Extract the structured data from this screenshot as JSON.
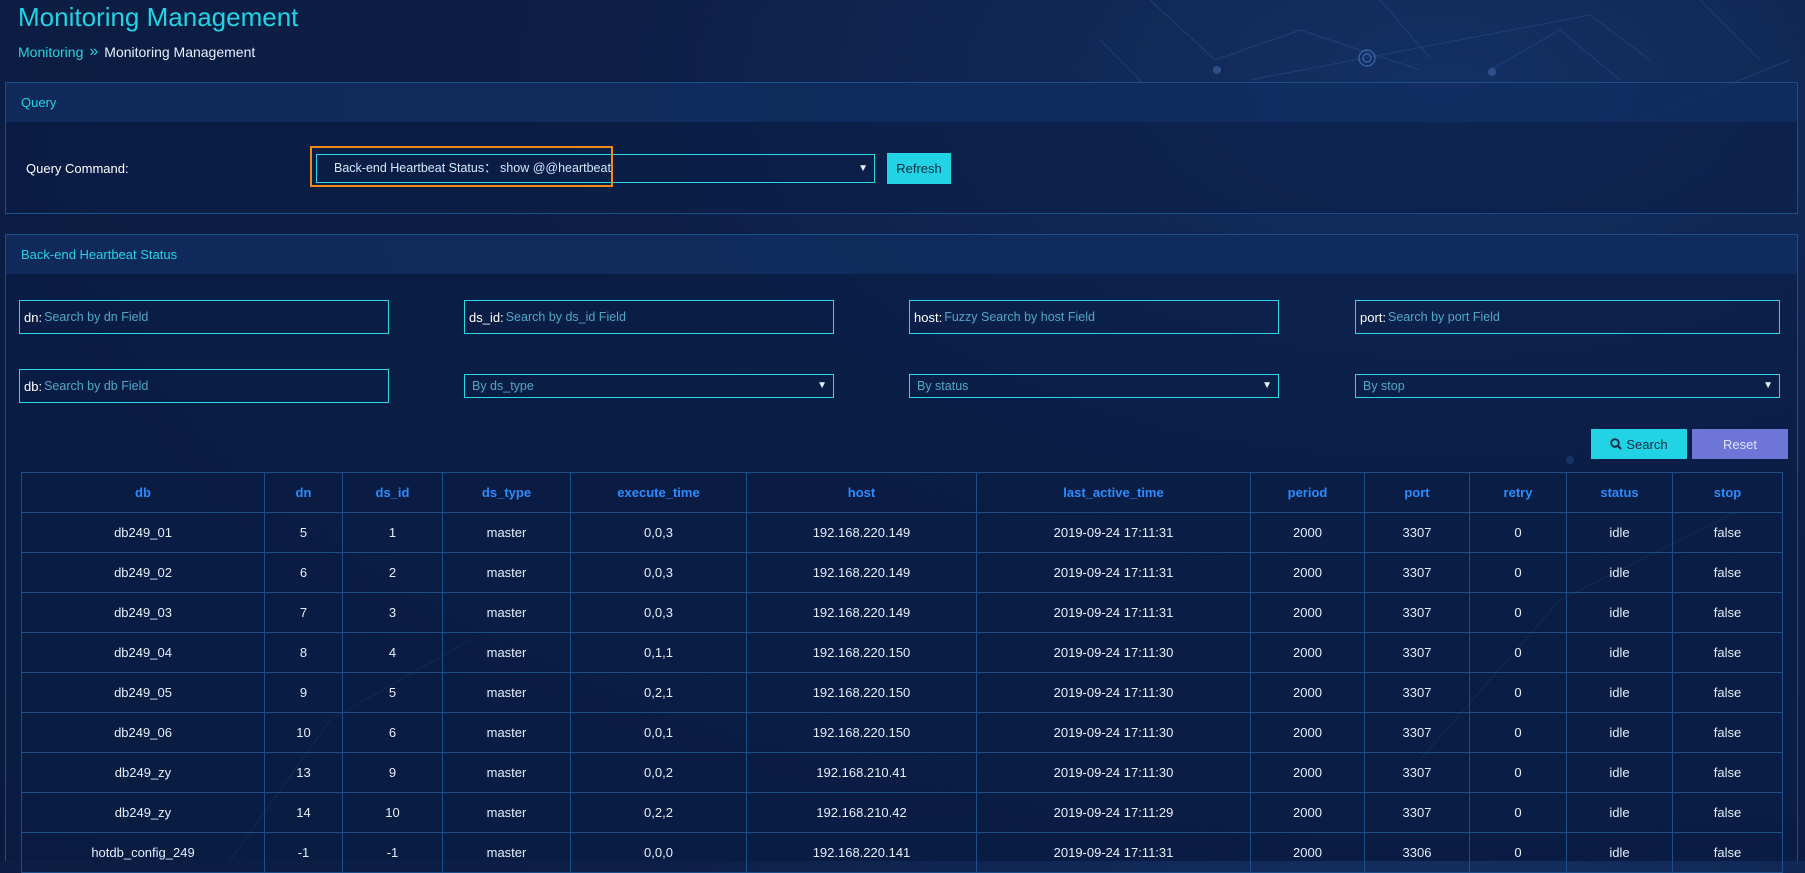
{
  "page": {
    "title": "Monitoring Management"
  },
  "breadcrumb": {
    "parent": "Monitoring",
    "current": "Monitoring Management"
  },
  "query_panel": {
    "title": "Query",
    "command_label": "Query Command:",
    "selected_command": "Back-end Heartbeat Status：  show @@heartbeat",
    "refresh_label": "Refresh",
    "highlight_color": "#f08a1a"
  },
  "status_panel": {
    "title": "Back-end Heartbeat Status",
    "filters": {
      "dn": {
        "label": "dn:",
        "placeholder": "Search by dn Field"
      },
      "ds_id": {
        "label": "ds_id:",
        "placeholder": "Search by ds_id Field"
      },
      "host": {
        "label": "host:",
        "placeholder": "Fuzzy Search by host Field"
      },
      "port": {
        "label": "port:",
        "placeholder": "Search by port Field"
      },
      "db": {
        "label": "db:",
        "placeholder": "Search by db Field"
      }
    },
    "dropdowns": {
      "ds_type": "By ds_type",
      "status": "By status",
      "stop": "By stop"
    },
    "search_label": "Search",
    "reset_label": "Reset"
  },
  "table": {
    "columns": [
      "db",
      "dn",
      "ds_id",
      "ds_type",
      "execute_time",
      "host",
      "last_active_time",
      "period",
      "port",
      "retry",
      "status",
      "stop"
    ],
    "rows": [
      [
        "db249_01",
        "5",
        "1",
        "master",
        "0,0,3",
        "192.168.220.149",
        "2019-09-24 17:11:31",
        "2000",
        "3307",
        "0",
        "idle",
        "false"
      ],
      [
        "db249_02",
        "6",
        "2",
        "master",
        "0,0,3",
        "192.168.220.149",
        "2019-09-24 17:11:31",
        "2000",
        "3307",
        "0",
        "idle",
        "false"
      ],
      [
        "db249_03",
        "7",
        "3",
        "master",
        "0,0,3",
        "192.168.220.149",
        "2019-09-24 17:11:31",
        "2000",
        "3307",
        "0",
        "idle",
        "false"
      ],
      [
        "db249_04",
        "8",
        "4",
        "master",
        "0,1,1",
        "192.168.220.150",
        "2019-09-24 17:11:30",
        "2000",
        "3307",
        "0",
        "idle",
        "false"
      ],
      [
        "db249_05",
        "9",
        "5",
        "master",
        "0,2,1",
        "192.168.220.150",
        "2019-09-24 17:11:30",
        "2000",
        "3307",
        "0",
        "idle",
        "false"
      ],
      [
        "db249_06",
        "10",
        "6",
        "master",
        "0,0,1",
        "192.168.220.150",
        "2019-09-24 17:11:30",
        "2000",
        "3307",
        "0",
        "idle",
        "false"
      ],
      [
        "db249_zy",
        "13",
        "9",
        "master",
        "0,0,2",
        "192.168.210.41",
        "2019-09-24 17:11:30",
        "2000",
        "3307",
        "0",
        "idle",
        "false"
      ],
      [
        "db249_zy",
        "14",
        "10",
        "master",
        "0,2,2",
        "192.168.210.42",
        "2019-09-24 17:11:29",
        "2000",
        "3307",
        "0",
        "idle",
        "false"
      ],
      [
        "hotdb_config_249",
        "-1",
        "-1",
        "master",
        "0,0,0",
        "192.168.220.141",
        "2019-09-24 17:11:31",
        "2000",
        "3306",
        "0",
        "idle",
        "false"
      ]
    ]
  },
  "colors": {
    "accent": "#22d3e6",
    "header_text": "#2b8cff",
    "reset_button": "#6d76d6",
    "background": "#0a1a3d"
  }
}
